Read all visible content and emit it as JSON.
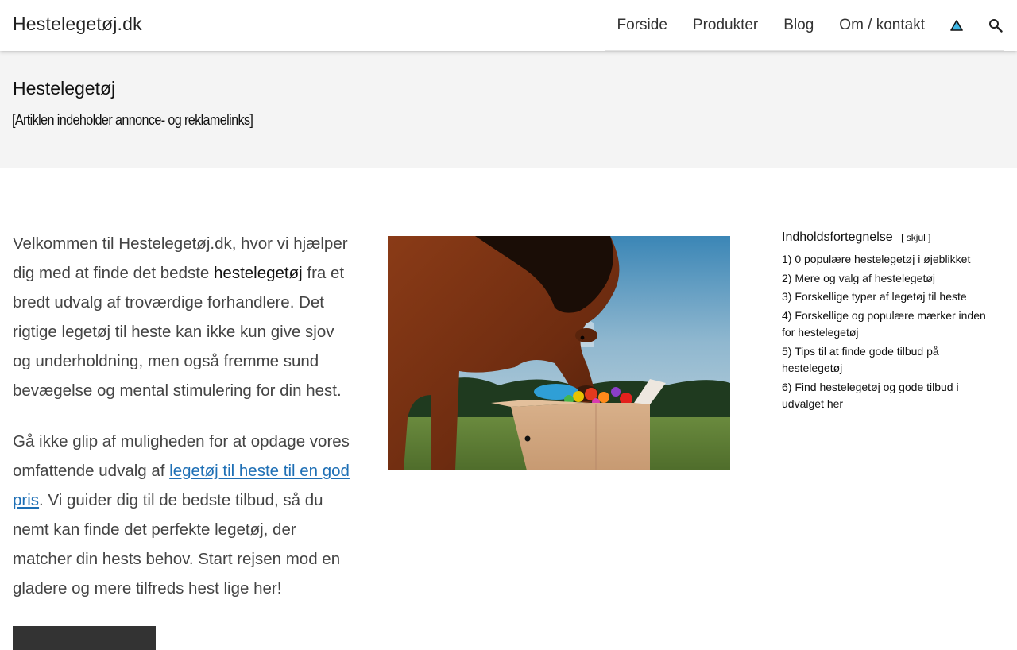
{
  "site": {
    "title": "Hestelegetøj.dk"
  },
  "nav": {
    "items": [
      {
        "label": "Forside"
      },
      {
        "label": "Produkter"
      },
      {
        "label": "Blog"
      },
      {
        "label": "Om / kontakt"
      }
    ],
    "icons": [
      "warning-triangle-icon",
      "search-icon"
    ]
  },
  "hero": {
    "title": "Hestelegetøj",
    "disclaimer": "[Artiklen indeholder annonce- og reklamelinks]"
  },
  "intro": {
    "p1_before": "Velkommen til Hestelegetøj.dk, hvor vi hjælper dig med at finde det bedste ",
    "p1_keyword": "hestelegetøj",
    "p1_after": " fra et bredt udvalg af troværdige forhandlere. Det rigtige legetøj til heste kan ikke kun give sjov og underholdning, men også fremme sund bevægelse og mental stimulering for din hest.",
    "p2_before": "Gå ikke glip af muligheden for at opdage vores omfattende udvalg af ",
    "p2_link": "legetøj til heste til en god pris",
    "p2_after": ". Vi guider dig til de bedste tilbud, så du nemt kan finde det perfekte legetøj, der matcher din hests behov. Start rejsen mod en gladere og mere tilfreds hest lige her!"
  },
  "toc": {
    "title": "Indholdsfortegnelse",
    "toggle_label": "[ skjul ]",
    "items": [
      "1) 0 populære hestelegetøj i øjeblikket",
      "2) Mere og valg af hestelegetøj",
      "3) Forskellige typer af legetøj til heste",
      "4) Forskellige og populære mærker inden for hestelegetøj",
      "5) Tips til at finde gode tilbud på hestelegetøj",
      "6) Find hestelegetøj og gode tilbud i udvalget her"
    ]
  },
  "colors": {
    "link": "#1e6fb5",
    "hero_background": "#f4f4f4",
    "cta_button": "#333333"
  }
}
